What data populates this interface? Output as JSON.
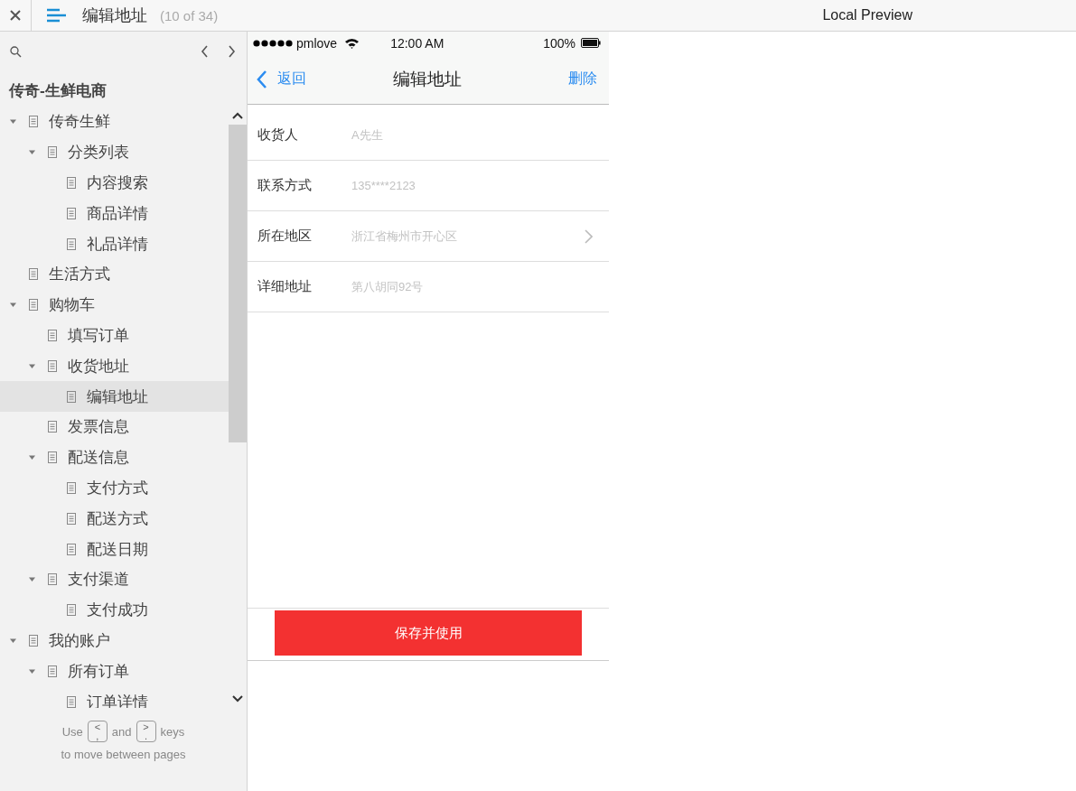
{
  "header": {
    "title": "编辑地址",
    "page_count": "(10 of 34)",
    "preview_label": "Local Preview"
  },
  "sidebar": {
    "project_title": "传奇-生鲜电商",
    "tree": [
      {
        "label": "传奇生鲜",
        "expanded": true,
        "selected": false,
        "children": [
          {
            "label": "分类列表",
            "expanded": true,
            "selected": false,
            "children": [
              {
                "label": "内容搜索",
                "selected": false
              },
              {
                "label": "商品详情",
                "selected": false
              },
              {
                "label": "礼品详情",
                "selected": false
              }
            ]
          }
        ]
      },
      {
        "label": "生活方式",
        "selected": false
      },
      {
        "label": "购物车",
        "expanded": true,
        "selected": false,
        "children": [
          {
            "label": "填写订单",
            "selected": false
          },
          {
            "label": "收货地址",
            "expanded": true,
            "selected": false,
            "children": [
              {
                "label": "编辑地址",
                "selected": true
              }
            ]
          },
          {
            "label": "发票信息",
            "selected": false
          },
          {
            "label": "配送信息",
            "expanded": true,
            "selected": false,
            "children": [
              {
                "label": "支付方式",
                "selected": false
              },
              {
                "label": "配送方式",
                "selected": false
              },
              {
                "label": "配送日期",
                "selected": false
              }
            ]
          },
          {
            "label": "支付渠道",
            "expanded": true,
            "selected": false,
            "children": [
              {
                "label": "支付成功",
                "selected": false
              }
            ]
          }
        ]
      },
      {
        "label": "我的账户",
        "expanded": true,
        "selected": false,
        "children": [
          {
            "label": "所有订单",
            "expanded": true,
            "selected": false,
            "children": [
              {
                "label": "订单详情",
                "selected": false
              }
            ]
          }
        ]
      }
    ],
    "hint": {
      "use": "Use",
      "key_prev": {
        "top": "<",
        "bottom": ","
      },
      "and": "and",
      "key_next": {
        "top": ">",
        "bottom": "."
      },
      "keys": "keys",
      "line2": "to move between pages"
    }
  },
  "phone": {
    "status_bar": {
      "carrier": "pmlove",
      "time": "12:00 AM",
      "battery": "100%"
    },
    "nav": {
      "back": "返回",
      "title": "编辑地址",
      "action": "删除"
    },
    "form": [
      {
        "kind": "text",
        "label": "收货人",
        "placeholder": "A先生"
      },
      {
        "kind": "text",
        "label": "联系方式",
        "placeholder": "135****2123"
      },
      {
        "kind": "select",
        "label": "所在地区",
        "placeholder": "浙江省梅州市开心区"
      },
      {
        "kind": "text",
        "label": "详细地址",
        "placeholder": "第八胡同92号"
      }
    ],
    "save_button": "保存并使用"
  }
}
